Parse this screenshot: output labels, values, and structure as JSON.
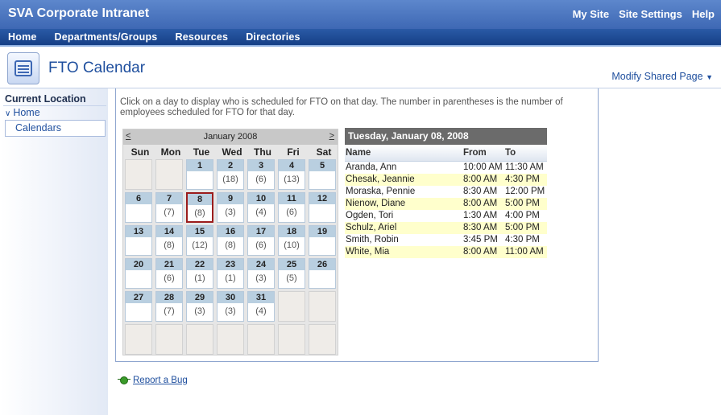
{
  "header": {
    "site_title": "SVA Corporate Intranet",
    "links": [
      "My Site",
      "Site Settings",
      "Help"
    ]
  },
  "nav": {
    "items": [
      "Home",
      "Departments/Groups",
      "Resources",
      "Directories"
    ]
  },
  "page": {
    "title": "FTO Calendar",
    "modify_label": "Modify Shared Page"
  },
  "leftnav": {
    "heading": "Current Location",
    "home": "Home",
    "current": "Calendars"
  },
  "instructions": "Click on a day to display who is scheduled for FTO on that day. The number in parentheses is the number of employees scheduled for FTO for that day.",
  "calendar": {
    "month_label": "January 2008",
    "prev": "<",
    "next": ">",
    "weekdays": [
      "Sun",
      "Mon",
      "Tue",
      "Wed",
      "Thu",
      "Fri",
      "Sat"
    ],
    "first_weekday_index": 2,
    "days_in_month": 31,
    "selected_day": 8,
    "counts": {
      "2": "(18)",
      "3": "(6)",
      "4": "(13)",
      "7": "(7)",
      "8": "(8)",
      "9": "(3)",
      "10": "(4)",
      "11": "(6)",
      "14": "(8)",
      "15": "(12)",
      "16": "(8)",
      "17": "(6)",
      "18": "(10)",
      "21": "(6)",
      "22": "(1)",
      "23": "(1)",
      "24": "(3)",
      "25": "(5)",
      "28": "(7)",
      "29": "(3)",
      "30": "(3)",
      "31": "(4)"
    }
  },
  "schedule": {
    "title": "Tuesday, January 08, 2008",
    "columns": [
      "Name",
      "From",
      "To"
    ],
    "rows": [
      {
        "name": "Aranda, Ann",
        "from": "10:00 AM",
        "to": "11:30 AM"
      },
      {
        "name": "Chesak, Jeannie",
        "from": "8:00 AM",
        "to": "4:30 PM"
      },
      {
        "name": "Moraska, Pennie",
        "from": "8:30 AM",
        "to": "12:00 PM"
      },
      {
        "name": "Nienow, Diane",
        "from": "8:00 AM",
        "to": "5:00 PM"
      },
      {
        "name": "Ogden, Tori",
        "from": "1:30 AM",
        "to": "4:00 PM"
      },
      {
        "name": "Schulz, Ariel",
        "from": "8:30 AM",
        "to": "5:00 PM"
      },
      {
        "name": "Smith, Robin",
        "from": "3:45 PM",
        "to": "4:30 PM"
      },
      {
        "name": "White, Mia",
        "from": "8:00 AM",
        "to": "11:00 AM"
      }
    ]
  },
  "footer": {
    "bug_link": "Report a Bug"
  },
  "icons": {
    "page_icon": "calendar-page-icon",
    "bug_icon": "bug-icon"
  },
  "colors": {
    "header_blue": "#3e68b4",
    "nav_blue": "#163f86",
    "link_blue": "#1f4f9e",
    "selected_border": "#9b1c1c",
    "alt_row": "#ffffcc"
  }
}
